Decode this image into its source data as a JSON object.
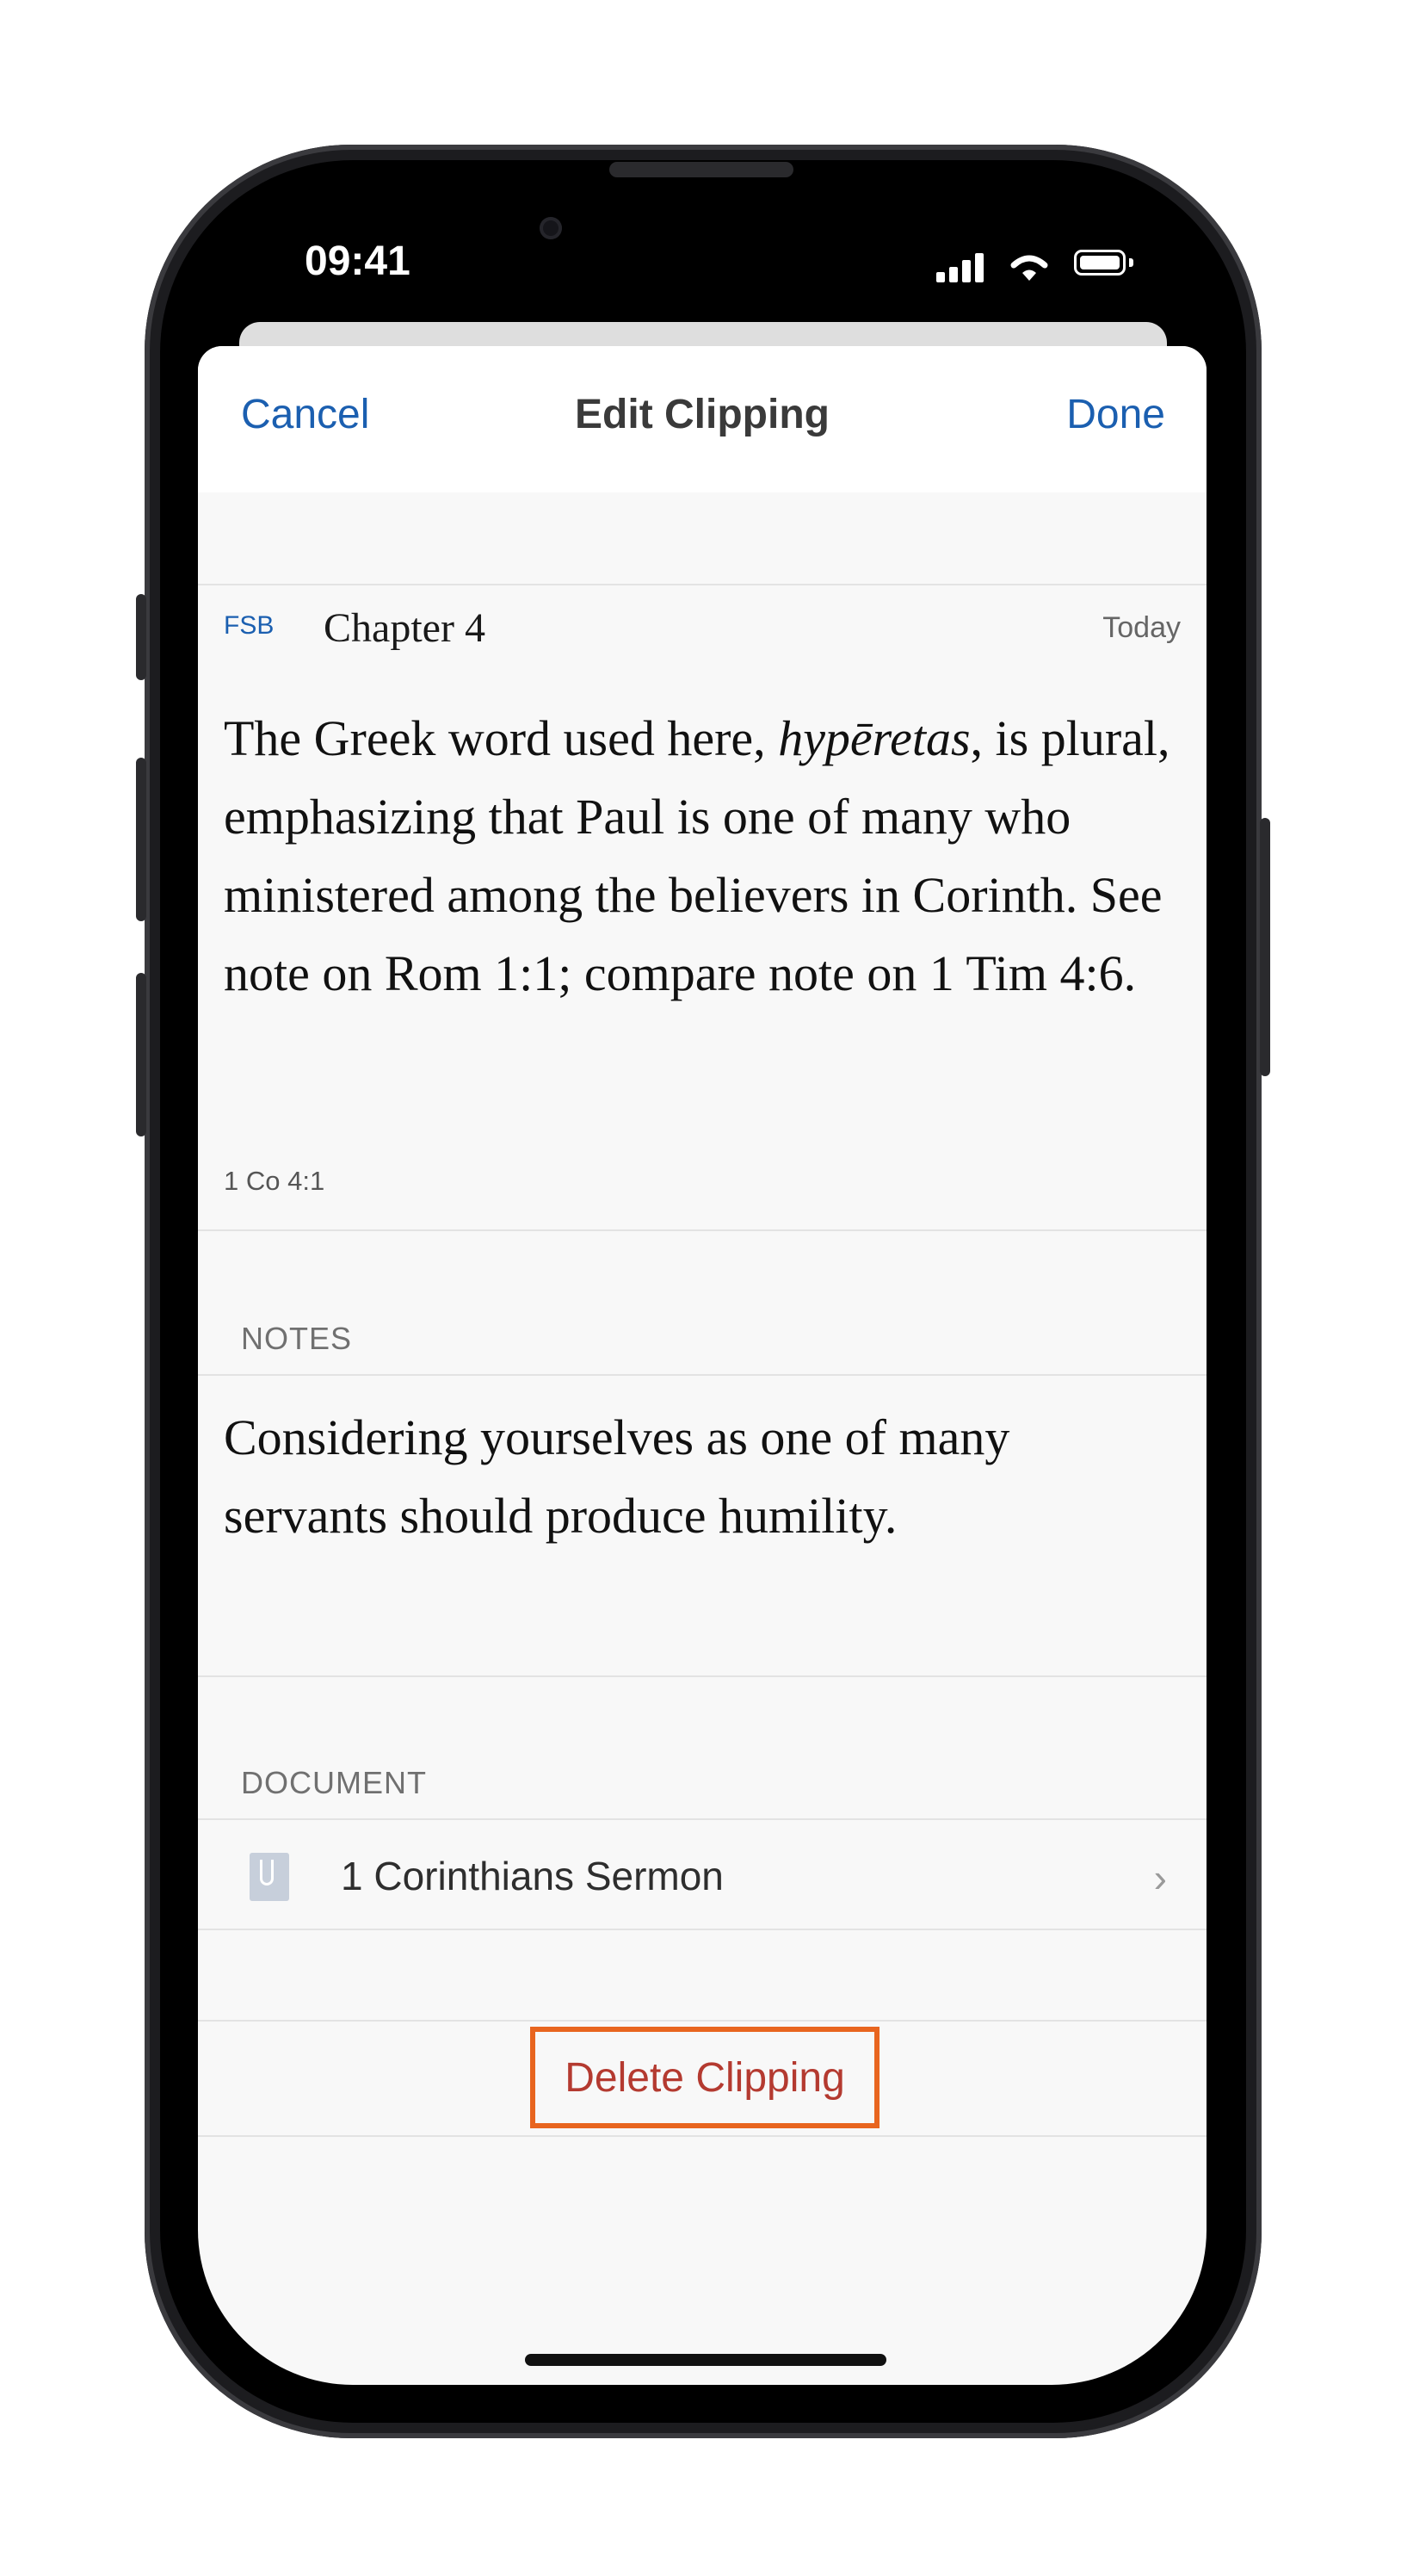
{
  "status_bar": {
    "time": "09:41"
  },
  "nav": {
    "cancel_label": "Cancel",
    "title": "Edit Clipping",
    "done_label": "Done"
  },
  "clipping": {
    "source": "FSB",
    "chapter": "Chapter 4",
    "date": "Today",
    "text_before": "The Greek word used here, ",
    "text_italic": "hypēretas",
    "text_after": ", is plural, emphasizing that Paul is one of many who ministered among the believers in Corinth. See note on Rom 1:1; compare note on 1 Tim 4:6.",
    "reference": "1 Co 4:1"
  },
  "notes": {
    "header": "NOTES",
    "text": "Considering yourselves as one of many servants should produce humility."
  },
  "document": {
    "header": "DOCUMENT",
    "name": "1 Corinthians Sermon",
    "icon": "document-icon"
  },
  "delete_label": "Delete Clipping",
  "colors": {
    "accent": "#1b5fb0",
    "destructive": "#b43a30",
    "highlight_outline": "#e8651f"
  }
}
